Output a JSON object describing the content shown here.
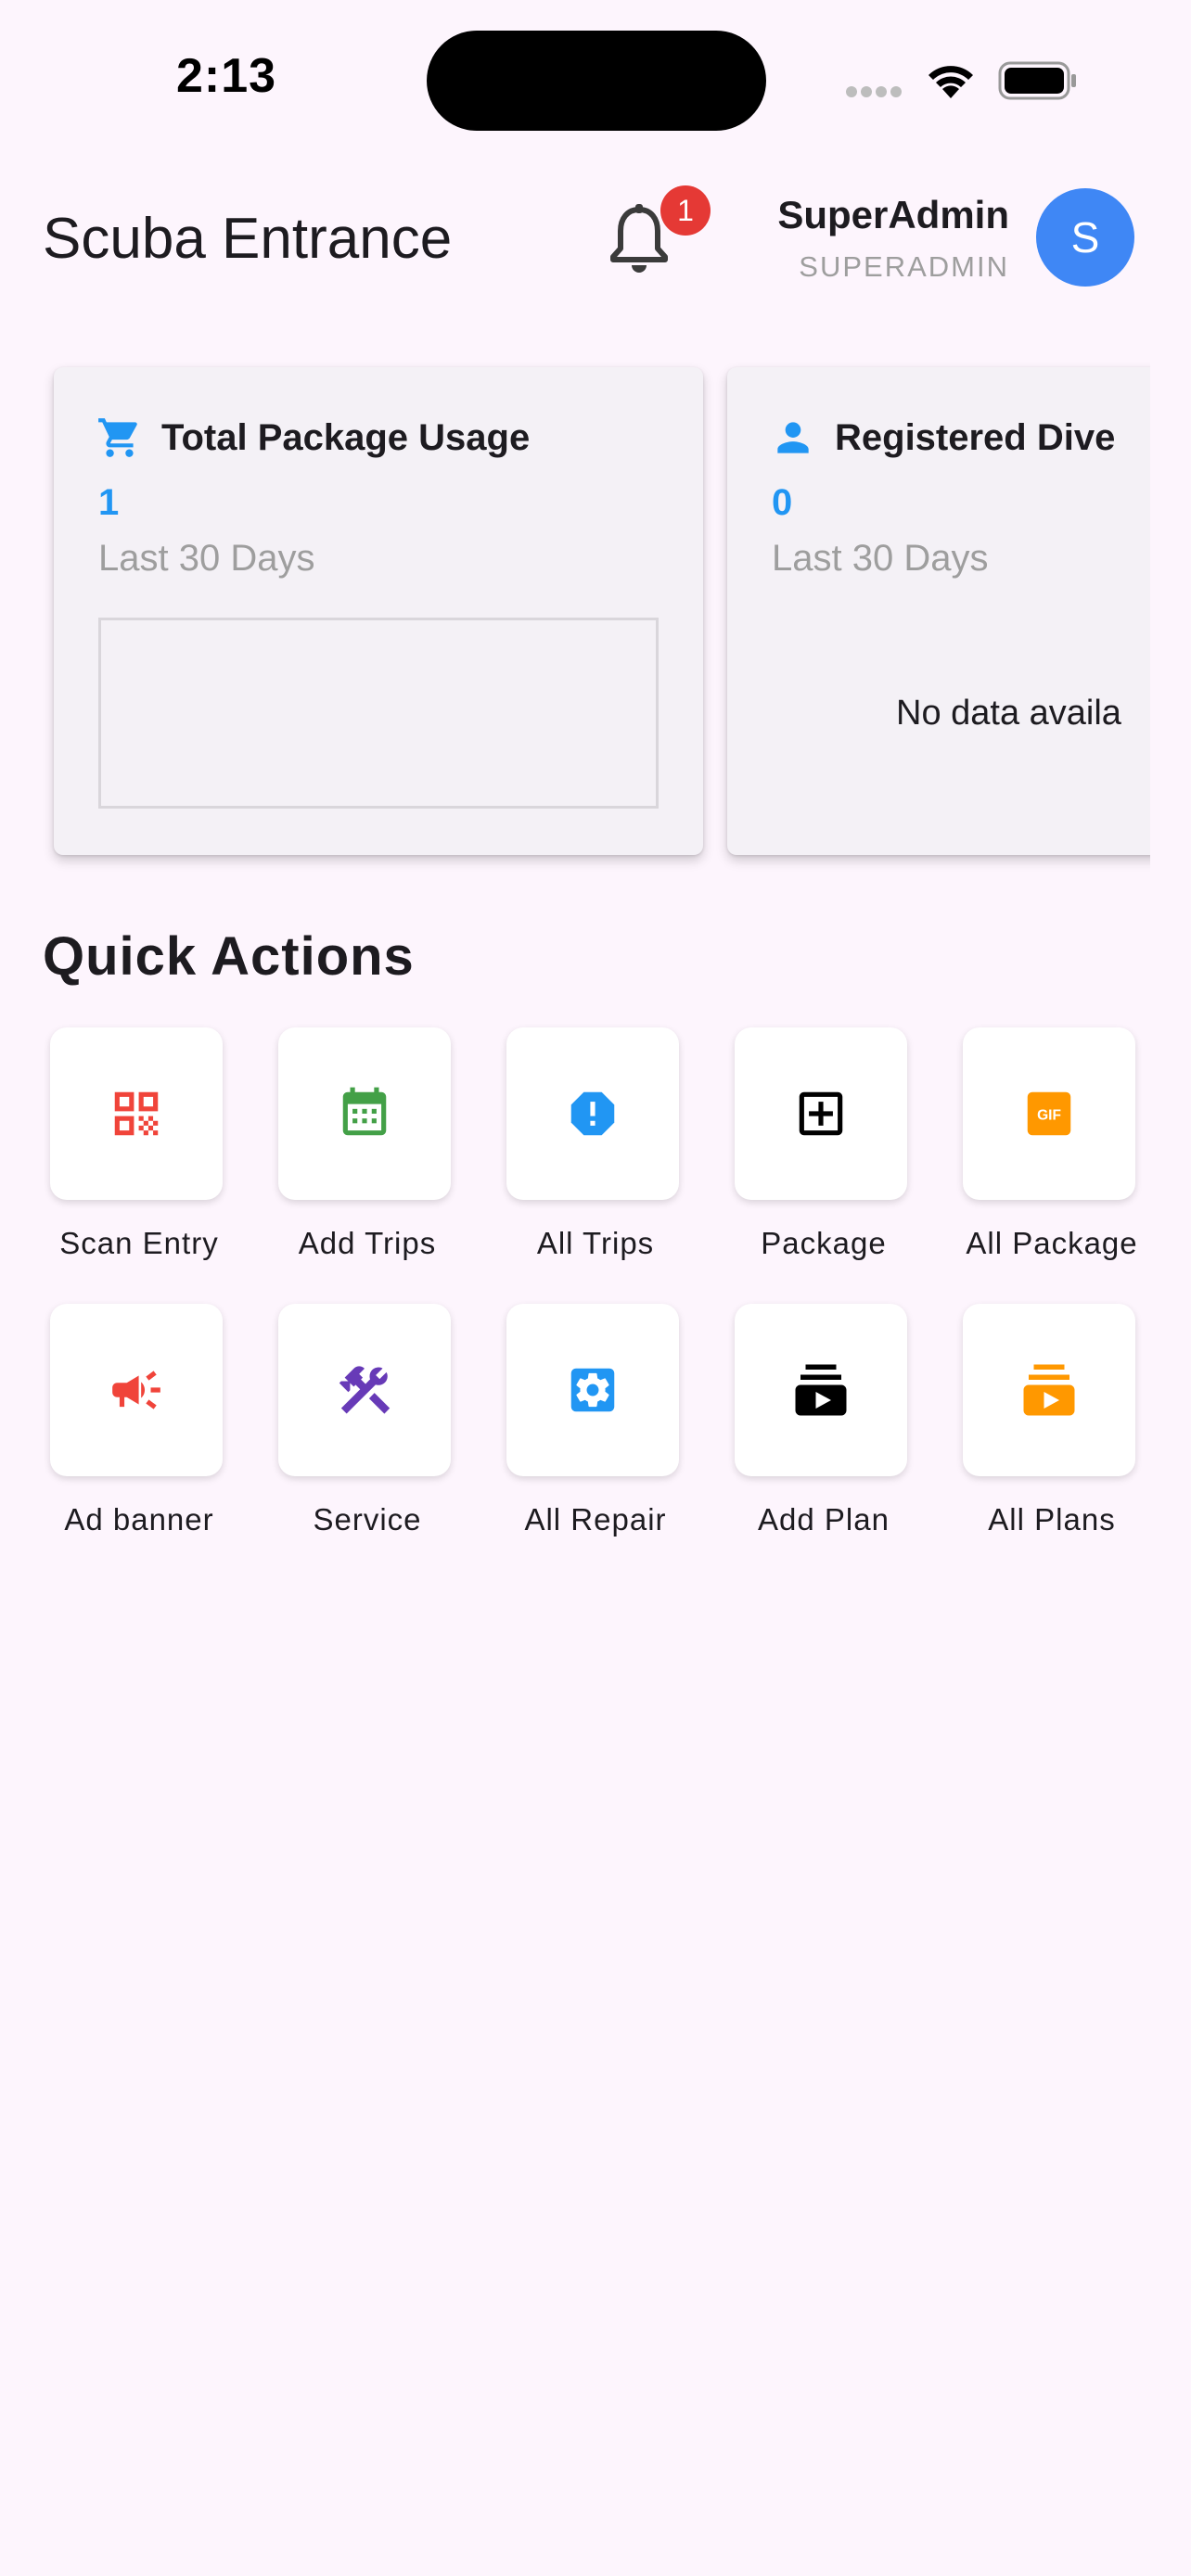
{
  "status_bar": {
    "time": "2:13"
  },
  "header": {
    "title": "Scuba Entrance",
    "notification_count": "1",
    "user_name": "SuperAdmin",
    "user_role": "SUPERADMIN",
    "avatar_letter": "S"
  },
  "cards": [
    {
      "icon": "shopping-cart-icon",
      "title": "Total Package Usage",
      "value": "1",
      "period": "Last 30 Days",
      "icon_color": "#2196f3"
    },
    {
      "icon": "person-icon",
      "title": "Registered Dive",
      "value": "0",
      "period": "Last 30 Days",
      "empty_text": "No data availa",
      "icon_color": "#2196f3"
    }
  ],
  "quick_actions": {
    "title": "Quick Actions",
    "items": [
      {
        "label": "Scan Entry",
        "icon": "qr-code-icon",
        "color": "#f0443a"
      },
      {
        "label": "Add Trips",
        "icon": "calendar-icon",
        "color": "#43a047"
      },
      {
        "label": "All Trips",
        "icon": "alert-octagon-icon",
        "color": "#2196f3"
      },
      {
        "label": "Package",
        "icon": "add-box-icon",
        "color": "#000000"
      },
      {
        "label": "All Package",
        "icon": "gif-icon",
        "color": "#ff9800"
      },
      {
        "label": "Ad banner",
        "icon": "campaign-icon",
        "color": "#f0443a"
      },
      {
        "label": "Service",
        "icon": "tools-icon",
        "color": "#673ab7"
      },
      {
        "label": "All Repair",
        "icon": "settings-icon",
        "color": "#2196f3"
      },
      {
        "label": "Add Plan",
        "icon": "subscriptions-icon",
        "color": "#000000"
      },
      {
        "label": "All Plans",
        "icon": "subscriptions-icon",
        "color": "#ff9800"
      }
    ]
  }
}
